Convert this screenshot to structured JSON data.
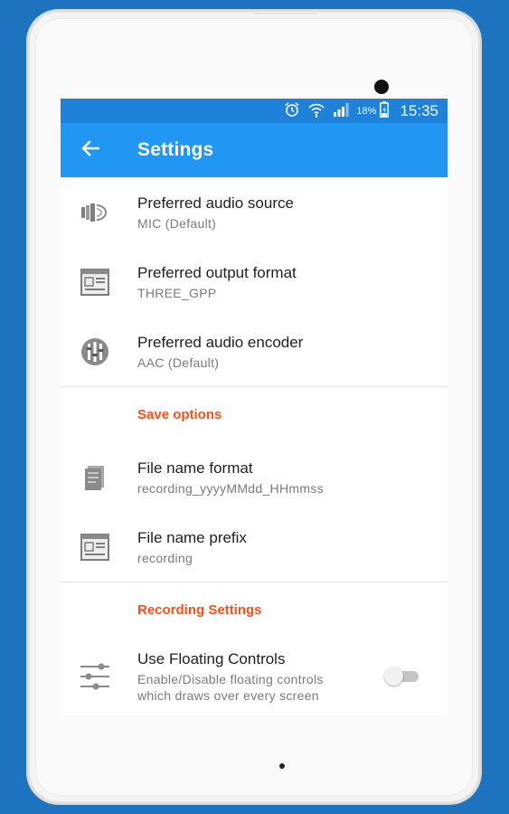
{
  "status_bar": {
    "icons": [
      "alarm-icon",
      "wifi-icon",
      "signal-icon",
      "battery-icon"
    ],
    "battery": "18%",
    "time": "15:35"
  },
  "app_bar": {
    "title": "Settings",
    "back_icon": "arrow-left-icon"
  },
  "preferences": [
    {
      "icon": "speaker-icon",
      "title": "Preferred audio source",
      "summary": "MIC (Default)"
    },
    {
      "icon": "format-icon",
      "title": "Preferred output format",
      "summary": "THREE_GPP"
    },
    {
      "icon": "encoder-icon",
      "title": "Preferred audio encoder",
      "summary": "AAC (Default)"
    }
  ],
  "save_options": {
    "header": "Save options",
    "items": [
      {
        "icon": "file-icon",
        "title": "File name format",
        "summary": "recording_yyyyMMdd_HHmmss"
      },
      {
        "icon": "format-icon",
        "title": "File name prefix",
        "summary": "recording"
      }
    ]
  },
  "recording_settings": {
    "header": "Recording Settings",
    "items": [
      {
        "icon": "sliders-icon",
        "title": "Use Floating Controls",
        "summary_line1": "Enable/Disable floating controls",
        "summary_line2": "which draws over every screen",
        "toggle_on": false
      }
    ]
  },
  "colors": {
    "background": "#1d73bd",
    "status_bar": "#1e82d9",
    "app_bar": "#2196f3",
    "category_accent": "#f4511e"
  }
}
